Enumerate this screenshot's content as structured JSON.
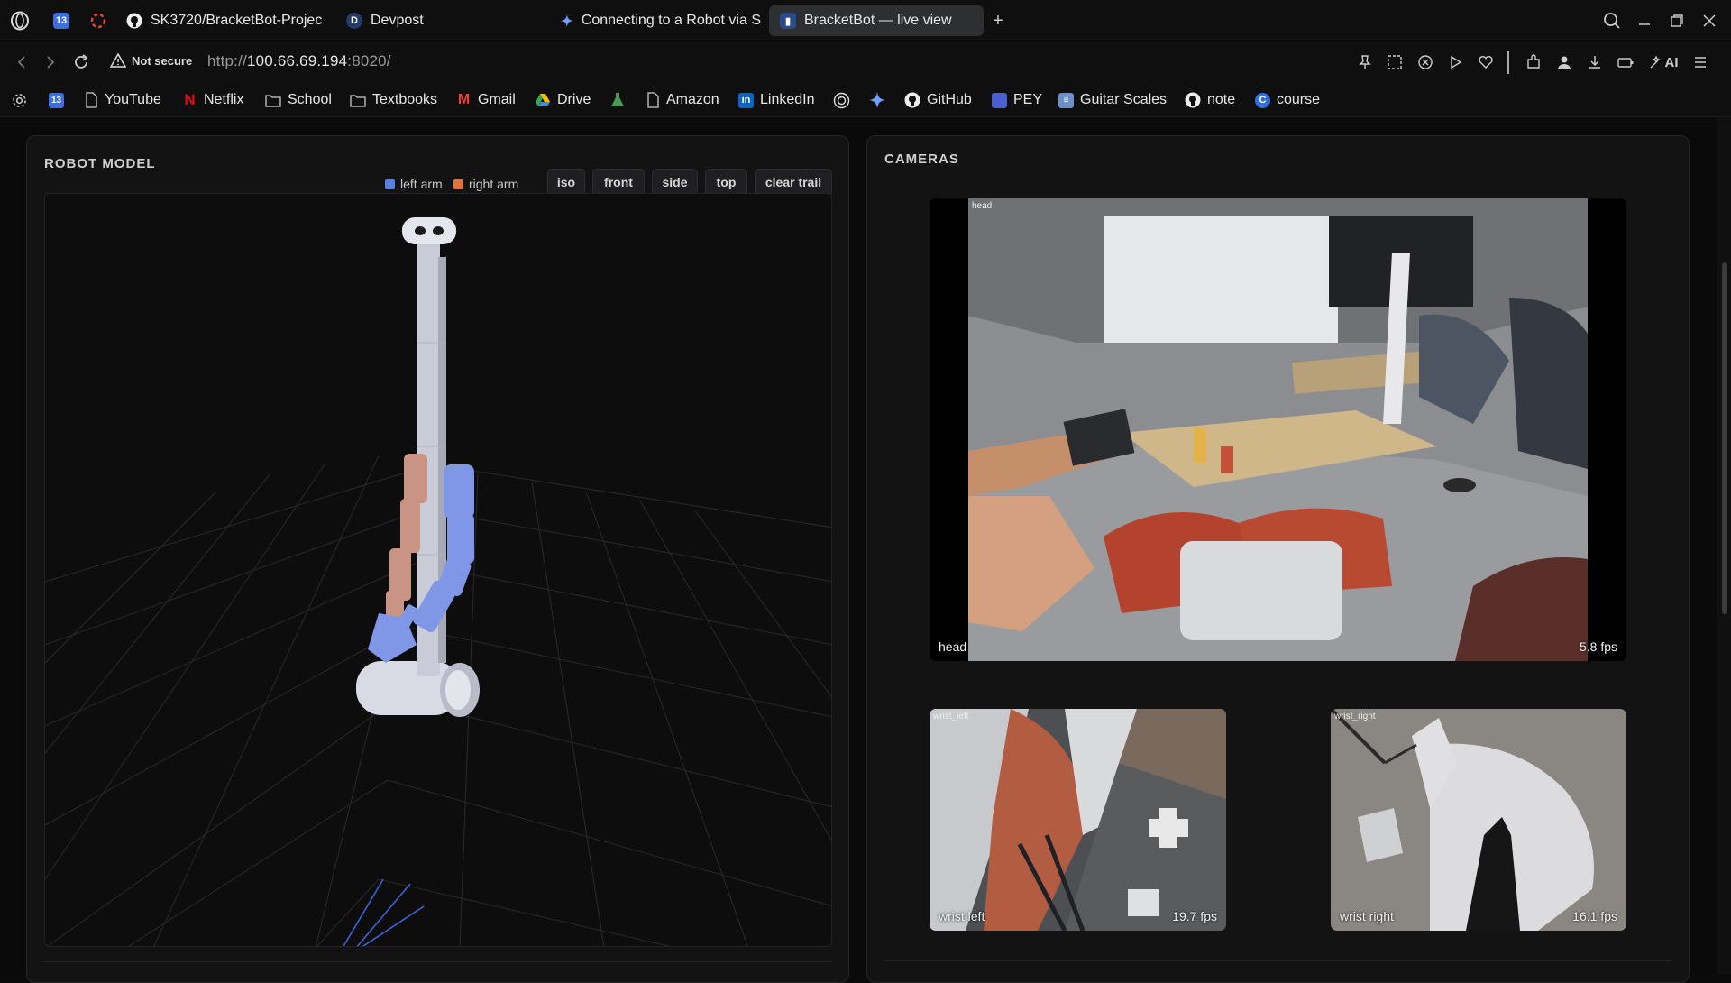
{
  "tabs": [
    {
      "title": "SK3720/BracketBot-Projec",
      "icon": "github-icon"
    },
    {
      "title": "Devpost",
      "icon": "devpost-icon"
    },
    {
      "title": "Connecting to a Robot via S",
      "icon": "gemini-icon"
    },
    {
      "title": "BracketBot — live view",
      "icon": "app-icon",
      "active": true
    }
  ],
  "pinned": {
    "calendar_badge": "13"
  },
  "address": {
    "security": "Not secure",
    "url_prefix": "http://",
    "url_host": "100.66.69.194",
    "url_port": ":8020/"
  },
  "toolbar": {
    "ai_label": "AI"
  },
  "bookmarks": [
    {
      "label": "",
      "icon": "calendar-icon",
      "badge": "13"
    },
    {
      "label": "YouTube",
      "icon": "file-icon"
    },
    {
      "label": "Netflix",
      "icon": "netflix-icon",
      "glyph": "N"
    },
    {
      "label": "School",
      "icon": "folder-icon"
    },
    {
      "label": "Textbooks",
      "icon": "folder-icon"
    },
    {
      "label": "Gmail",
      "icon": "gmail-icon",
      "glyph": "M"
    },
    {
      "label": "Drive",
      "icon": "drive-icon"
    },
    {
      "label": "",
      "icon": "flask-icon"
    },
    {
      "label": "Amazon",
      "icon": "file-icon"
    },
    {
      "label": "LinkedIn",
      "icon": "linkedin-icon",
      "glyph": "in"
    },
    {
      "label": "",
      "icon": "openai-icon"
    },
    {
      "label": "",
      "icon": "gemini-icon"
    },
    {
      "label": "GitHub",
      "icon": "github-icon"
    },
    {
      "label": "PEY",
      "icon": "pey-icon"
    },
    {
      "label": "Guitar Scales",
      "icon": "guitar-scales-icon"
    },
    {
      "label": "note",
      "icon": "github-icon"
    },
    {
      "label": "course",
      "icon": "course-icon",
      "glyph": "C"
    }
  ],
  "robot_model": {
    "title": "ROBOT MODEL",
    "legend": [
      {
        "label": "left arm",
        "color": "#5b7fe0"
      },
      {
        "label": "right arm",
        "color": "#e0743f"
      }
    ],
    "view_buttons": [
      "iso",
      "front",
      "side",
      "top",
      "clear trail"
    ]
  },
  "cameras": {
    "title": "CAMERAS",
    "head": {
      "label": "head",
      "tag": "head",
      "fps": "5.8 fps"
    },
    "wrist_left": {
      "label": "wrist left",
      "tag": "wrist_left",
      "fps": "19.7 fps"
    },
    "wrist_right": {
      "label": "wrist right",
      "tag": "wrist_right",
      "fps": "16.1 fps"
    }
  },
  "colors": {
    "left_arm": "#7f97e6",
    "right_arm": "#c99483",
    "body": "#c9ccd6"
  }
}
